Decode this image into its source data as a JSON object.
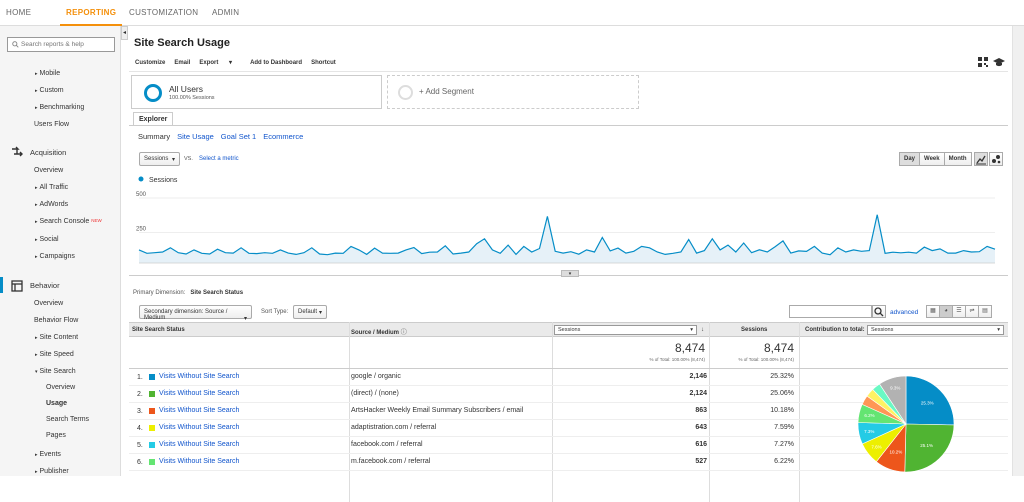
{
  "topnav": {
    "home": "HOME",
    "reporting": "REPORTING",
    "customization": "CUSTOMIZATION",
    "admin": "ADMIN"
  },
  "sidebar": {
    "search_placeholder": "Search reports & help",
    "audience_items": [
      "Mobile",
      "Custom",
      "Benchmarking"
    ],
    "users_flow": "Users Flow",
    "acquisition": "Acquisition",
    "acq_items": {
      "overview": "Overview",
      "all_traffic": "All Traffic",
      "adwords": "AdWords",
      "search_console": "Search Console",
      "new_badge": "NEW",
      "social": "Social",
      "campaigns": "Campaigns"
    },
    "behavior": "Behavior",
    "beh_items": {
      "overview": "Overview",
      "behavior_flow": "Behavior Flow",
      "site_content": "Site Content",
      "site_speed": "Site Speed",
      "site_search": "Site Search",
      "ss_overview": "Overview",
      "ss_usage": "Usage",
      "ss_terms": "Search Terms",
      "ss_pages": "Pages",
      "events": "Events",
      "publisher": "Publisher"
    }
  },
  "page": {
    "title": "Site Search Usage"
  },
  "toolbar": {
    "customize": "Customize",
    "email": "Email",
    "export": "Export",
    "add_dashboard": "Add to Dashboard",
    "shortcut": "Shortcut"
  },
  "segments": {
    "all_users": "All Users",
    "all_users_sub": "100.00% Sessions",
    "add_segment": "+ Add Segment"
  },
  "explorer": {
    "tab": "Explorer",
    "subtabs": [
      "Summary",
      "Site Usage",
      "Goal Set 1",
      "Ecommerce"
    ]
  },
  "chart_controls": {
    "metric": "Sessions",
    "vs": "VS.",
    "select_metric": "Select a metric",
    "day": "Day",
    "week": "Week",
    "month": "Month"
  },
  "chart_data": {
    "type": "line",
    "series": [
      {
        "name": "Sessions",
        "values": [
          95,
          70,
          75,
          80,
          110,
          75,
          65,
          95,
          70,
          65,
          100,
          75,
          72,
          110,
          70,
          68,
          75,
          70,
          95,
          72,
          62,
          75,
          110,
          65,
          60,
          72,
          70,
          120,
          95,
          62,
          108,
          72,
          70,
          72,
          95,
          112,
          68,
          78,
          80,
          125,
          65,
          72,
          80,
          140,
          175,
          95,
          70,
          130,
          62,
          120,
          80,
          105,
          338,
          85,
          72,
          82,
          64,
          95,
          80,
          185,
          88,
          108,
          72,
          85,
          120,
          110,
          80,
          62,
          70,
          80,
          170,
          72,
          90,
          175,
          95,
          130,
          80,
          145,
          75,
          96,
          80,
          118,
          160,
          72,
          88,
          84,
          120,
          72,
          60,
          110,
          80,
          95,
          85,
          90,
          350,
          70,
          78,
          74,
          78,
          72,
          115,
          90,
          102,
          72,
          72,
          90,
          80,
          82,
          120,
          100
        ]
      }
    ],
    "ylim": [
      0,
      500
    ],
    "yticks": [
      250,
      500
    ],
    "legend": "top-left",
    "color": "#058dc7"
  },
  "table": {
    "primary_dim_label": "Primary Dimension:",
    "primary_dim": "Site Search Status",
    "secondary_dim": "Secondary dimension: Source / Medium",
    "sort_type_label": "Sort Type:",
    "sort_type": "Default",
    "advanced": "advanced",
    "headers": {
      "status": "Site Search Status",
      "source": "Source / Medium",
      "sessions_sel": "Sessions",
      "sessions": "Sessions",
      "contribution": "Contribution to total:",
      "contribution_sel": "Sessions"
    },
    "totals": {
      "sessions": "8,474",
      "sessions_sub": "% of Total: 100.00% (8,474)",
      "sessions2": "8,474",
      "sessions2_sub": "% of Total: 100.00% (8,474)"
    },
    "rows": [
      {
        "idx": "1.",
        "name": "Visits Without Site Search",
        "src": "google / organic",
        "sess": "2,146",
        "pct": "25.32%",
        "color": "#058dc7"
      },
      {
        "idx": "2.",
        "name": "Visits Without Site Search",
        "src": "(direct) / (none)",
        "sess": "2,124",
        "pct": "25.06%",
        "color": "#50b432"
      },
      {
        "idx": "3.",
        "name": "Visits Without Site Search",
        "src": "ArtsHacker Weekly Email Summary Subscribers / email",
        "sess": "863",
        "pct": "10.18%",
        "color": "#ed561b"
      },
      {
        "idx": "4.",
        "name": "Visits Without Site Search",
        "src": "adaptistration.com / referral",
        "sess": "643",
        "pct": "7.59%",
        "color": "#edef00"
      },
      {
        "idx": "5.",
        "name": "Visits Without Site Search",
        "src": "facebook.com / referral",
        "sess": "616",
        "pct": "7.27%",
        "color": "#24cbe5"
      },
      {
        "idx": "6.",
        "name": "Visits Without Site Search",
        "src": "m.facebook.com / referral",
        "sess": "527",
        "pct": "6.22%",
        "color": "#64e572"
      }
    ]
  },
  "pie_data": {
    "slices": [
      {
        "value": 25.3,
        "label": "25.3%",
        "color": "#058dc7"
      },
      {
        "value": 25.1,
        "label": "25.1%",
        "color": "#50b432"
      },
      {
        "value": 10.2,
        "label": "10.2%",
        "color": "#ed561b"
      },
      {
        "value": 7.6,
        "label": "7.6%",
        "color": "#edef00"
      },
      {
        "value": 7.3,
        "label": "7.3%",
        "color": "#24cbe5"
      },
      {
        "value": 6.2,
        "label": "6.2%",
        "color": "#64e572"
      },
      {
        "value": 3.2,
        "label": "",
        "color": "#ff9655"
      },
      {
        "value": 2.9,
        "label": "",
        "color": "#fff263"
      },
      {
        "value": 2.9,
        "label": "",
        "color": "#6af9c4"
      },
      {
        "value": 9.3,
        "label": "9.3%",
        "color": "#b2b2b2"
      }
    ]
  }
}
